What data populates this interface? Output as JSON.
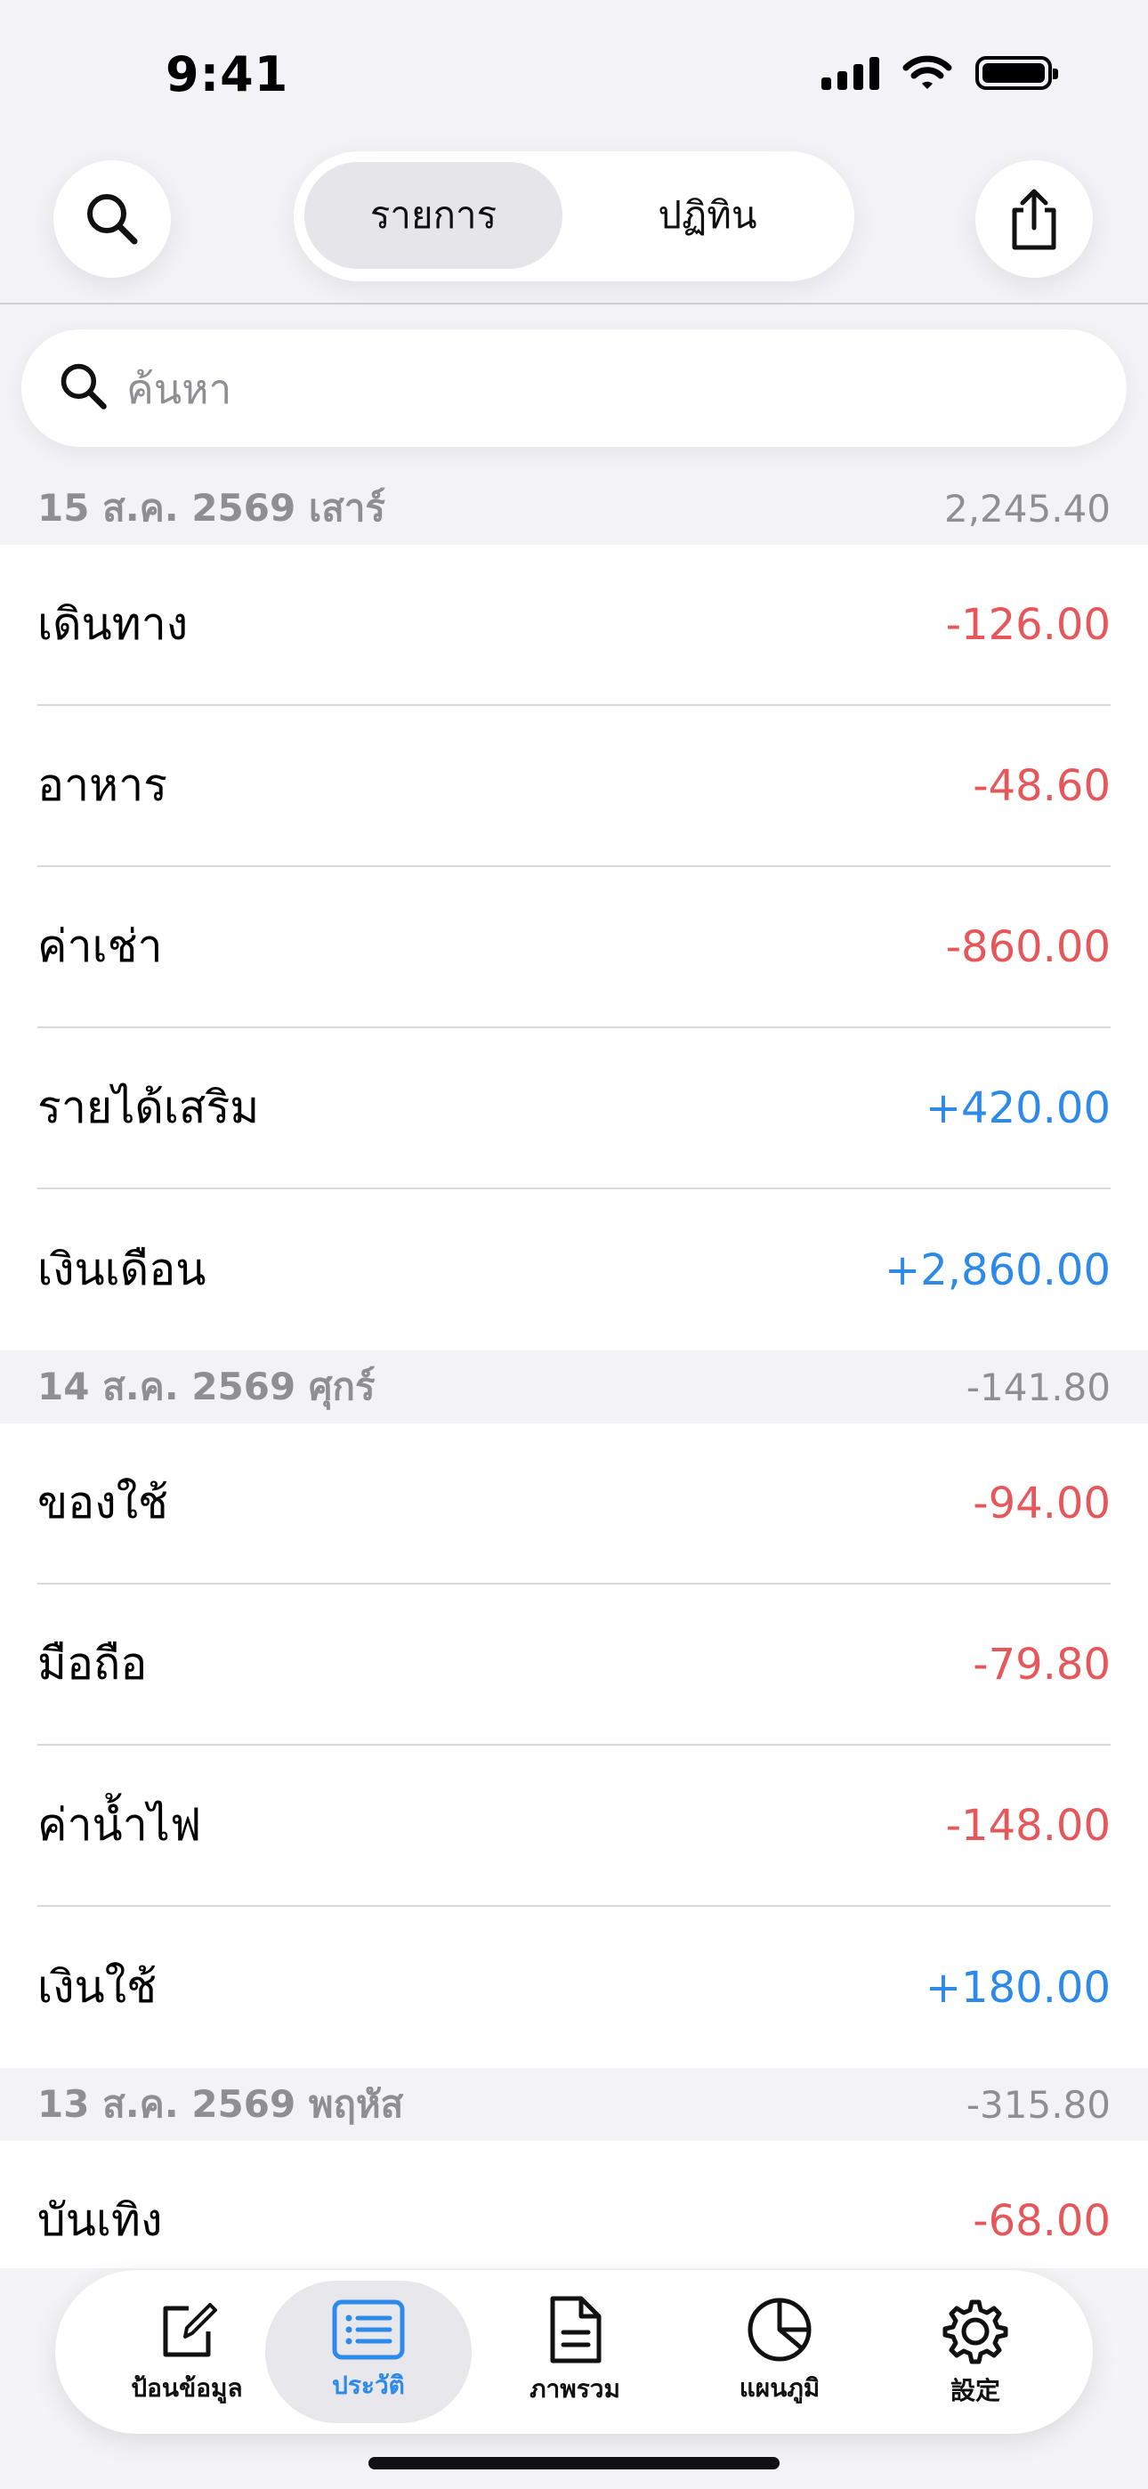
{
  "status_bar": {
    "time": "9:41"
  },
  "header": {
    "segments": [
      {
        "label": "รายการ",
        "selected": true
      },
      {
        "label": "ปฏิทิน",
        "selected": false
      }
    ]
  },
  "search": {
    "placeholder": "ค้นหา"
  },
  "groups": [
    {
      "date": "15 ส.ค. 2569 เสาร์",
      "total": "2,245.40",
      "items": [
        {
          "name": "เดินทาง",
          "amount": "-126.00",
          "type": "expense"
        },
        {
          "name": "อาหาร",
          "amount": "-48.60",
          "type": "expense"
        },
        {
          "name": "ค่าเช่า",
          "amount": "-860.00",
          "type": "expense"
        },
        {
          "name": "รายได้เสริม",
          "amount": "+420.00",
          "type": "income"
        },
        {
          "name": "เงินเดือน",
          "amount": "+2,860.00",
          "type": "income"
        }
      ]
    },
    {
      "date": "14 ส.ค. 2569 ศุกร์",
      "total": "-141.80",
      "items": [
        {
          "name": "ของใช้",
          "amount": "-94.00",
          "type": "expense"
        },
        {
          "name": "มือถือ",
          "amount": "-79.80",
          "type": "expense"
        },
        {
          "name": "ค่าน้ำไฟ",
          "amount": "-148.00",
          "type": "expense"
        },
        {
          "name": "เงินใช้",
          "amount": "+180.00",
          "type": "income"
        }
      ]
    },
    {
      "date": "13 ส.ค. 2569 พฤหัส",
      "total": "-315.80",
      "items": [
        {
          "name": "บันเทิง",
          "amount": "-68.00",
          "type": "expense"
        }
      ]
    }
  ],
  "tabbar": {
    "tabs": [
      {
        "label": "ป้อนข้อมูล",
        "icon": "compose-icon"
      },
      {
        "label": "ประวัติ",
        "icon": "list-icon",
        "active": true
      },
      {
        "label": "ภาพรวม",
        "icon": "document-icon"
      },
      {
        "label": "แผนภูมิ",
        "icon": "pie-chart-icon"
      },
      {
        "label": "設定",
        "icon": "gear-icon"
      }
    ]
  },
  "colors": {
    "expense": "#e5575b",
    "income": "#2d8ae8",
    "accent": "#2d8ae8"
  }
}
